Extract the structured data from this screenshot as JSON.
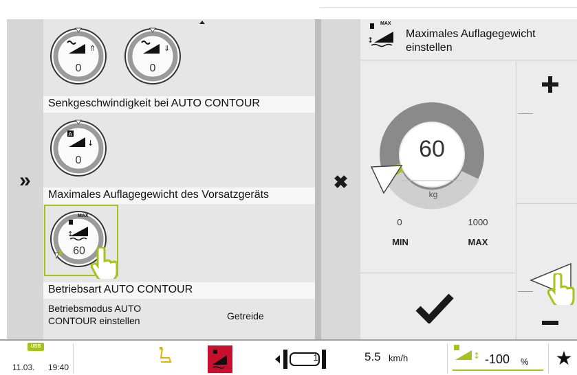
{
  "list": {
    "row1_icons": [
      {
        "value": "0",
        "icon": "lower-speed-up-icon"
      },
      {
        "value": "0",
        "icon": "lower-speed-down-icon"
      }
    ],
    "row1_label": "Senkgeschwindigkeit bei AUTO CONTOUR",
    "row2_icon": {
      "value": "0",
      "icon": "auto-lower-icon"
    },
    "row2_label": "Maximales Auflagegewicht des Vorsatzgeräts",
    "row3_icon": {
      "value": "60",
      "icon": "max-weight-icon",
      "badge": "MAX"
    },
    "row3_label": "Betriebsart AUTO CONTOUR",
    "row4_label": "Betriebsmodus AUTO CONTOUR einstellen",
    "row4_value": "Getreide"
  },
  "dialog": {
    "title": "Maximales Auflagegewicht einstellen",
    "title_badge": "MAX",
    "value": "60",
    "unit": "kg",
    "min_value": "0",
    "max_value": "1000",
    "min_label": "MIN",
    "max_label": "MAX",
    "fill_fraction": 0.06
  },
  "status": {
    "usb": "USB",
    "date": "11.03.",
    "time": "19:40",
    "gear": "1",
    "speed_value": "5.5",
    "speed_unit": "km/h",
    "percent_value": "-100",
    "percent_unit": "%"
  },
  "colors": {
    "accent": "#a6c21f",
    "badge_red": "#c8102e",
    "gauge_dark": "#8a8a8a",
    "gauge_light": "#cfcfcf"
  }
}
